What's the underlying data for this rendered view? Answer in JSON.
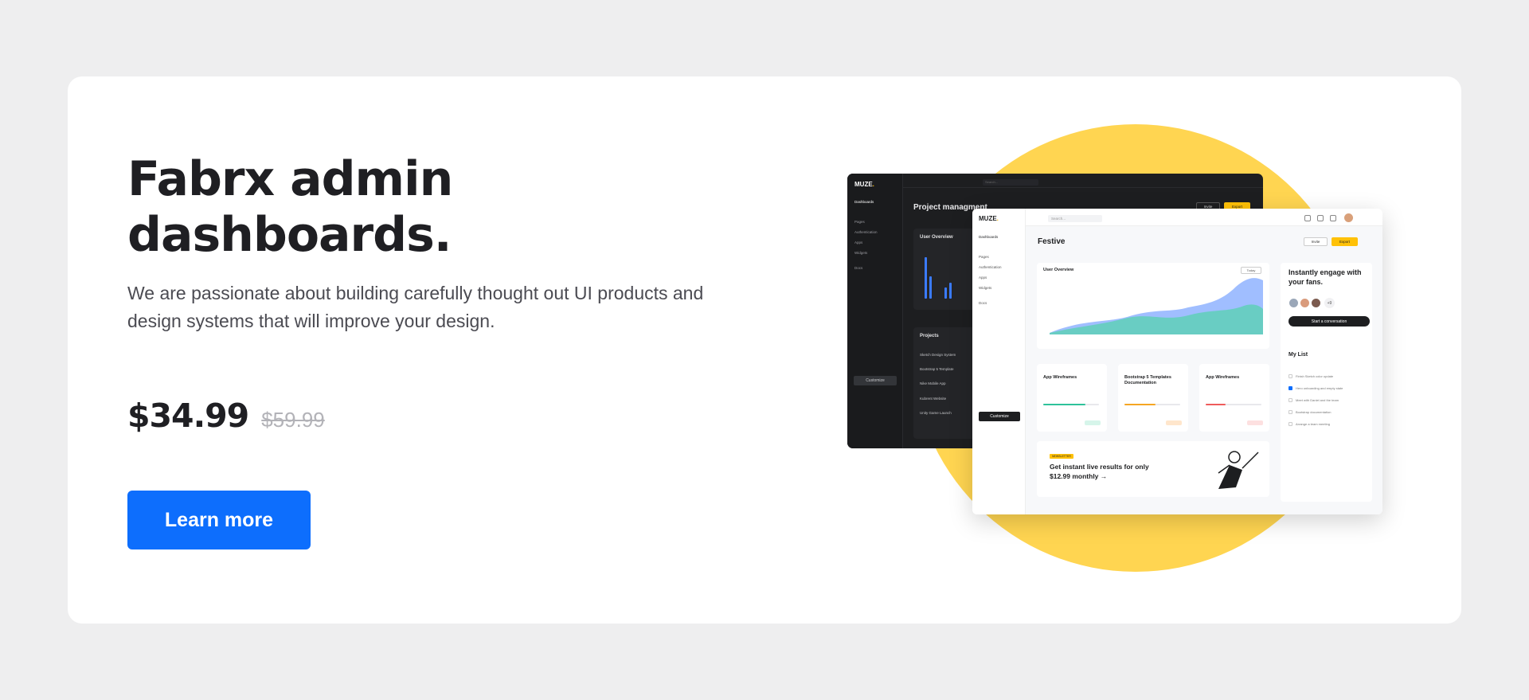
{
  "hero": {
    "headline_line1": "Fabrx admin",
    "headline_line2": "dashboards.",
    "subtitle": "We are passionate about building carefully thought out UI products and design systems that will improve your design.",
    "price": "$34.99",
    "old_price": "$59.99",
    "cta_label": "Learn more"
  },
  "colors": {
    "accent": "#0d6efd",
    "circle": "#ffd551",
    "brand_yellow": "#ffc107"
  },
  "dark_dashboard": {
    "logo": "MUZE",
    "search_placeholder": "Search...",
    "page_title": "Project managment",
    "invite": "Invite",
    "export": "Export",
    "nav": [
      "Dashboards",
      "Pages",
      "Authentication",
      "Apps",
      "Widgets",
      "Docs"
    ],
    "customize": "Customize",
    "overview_title": "User Overview",
    "projects_title": "Projects",
    "projects": [
      "Sketch Design System",
      "Bootstrap 5 Template",
      "Nike Mobile App",
      "Kubrent Website",
      "Unity Game Launch"
    ]
  },
  "light_dashboard": {
    "logo": "MUZE",
    "search_placeholder": "Search...",
    "page_title": "Festive",
    "invite": "Invite",
    "export": "Export",
    "nav": [
      "Dashboards",
      "Pages",
      "Authentication",
      "Apps",
      "Widgets",
      "Docs"
    ],
    "customize": "Customize",
    "overview_title": "User Overview",
    "overview_filter": "Today",
    "cards": [
      {
        "title": "App Wireframes"
      },
      {
        "title": "Bootstrap 5 Templates Documentation"
      },
      {
        "title": "App Wireframes"
      }
    ],
    "promo_badge": "NEWSLETTER",
    "promo_text": "Get instant live results for only $12.99 monthly →",
    "engage_title": "Instantly engage with your fans.",
    "more_faces": "+9",
    "convo_button": "Start a conversation",
    "mylist_title": "My List",
    "tasks": [
      "Finish Sketch color update",
      "Hero onboarding and empty state",
      "Meet with Daniel and the team",
      "Bootstrap documentation",
      "Arrange a team meeting"
    ]
  }
}
